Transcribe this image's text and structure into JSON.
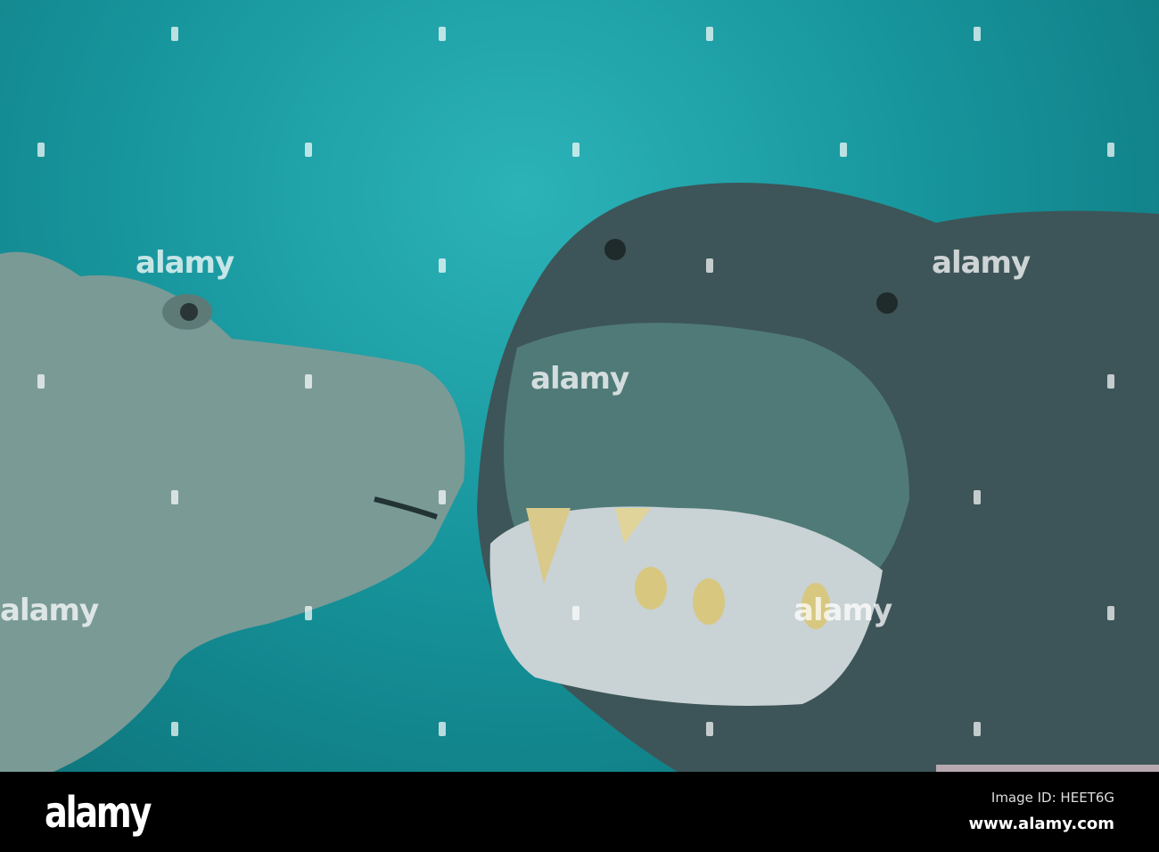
{
  "watermark": {
    "text": "alamy"
  },
  "footer": {
    "logo": "alamy",
    "image_id": "Image ID: HEET6G",
    "website": "www.alamy.com"
  },
  "colors": {
    "water": "#17959c",
    "footer_bg": "#000000"
  }
}
